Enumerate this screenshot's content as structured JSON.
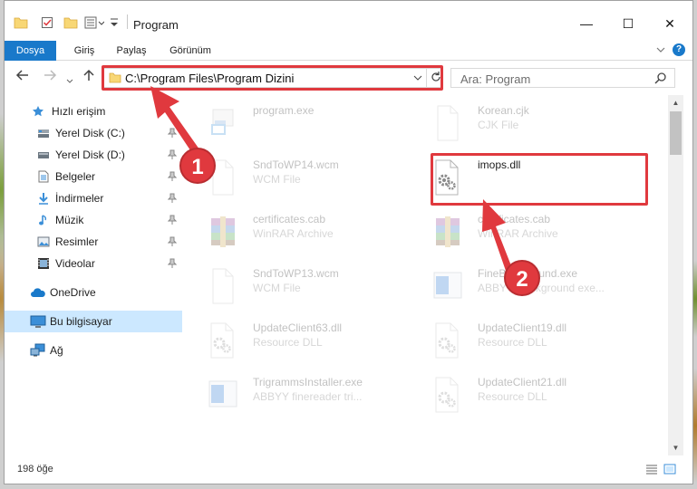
{
  "window": {
    "title": "Program",
    "controls": {
      "minimize": "—",
      "maximize": "☐",
      "close": "✕"
    }
  },
  "ribbon": {
    "tabs": [
      "Dosya",
      "Giriş",
      "Paylaş",
      "Görünüm"
    ],
    "help": "?",
    "accent": "#1979ca"
  },
  "address": {
    "path": "C:\\Program Files\\Program Dizini",
    "search_placeholder": "Ara: Program"
  },
  "nav": {
    "items": [
      {
        "label": "Hızlı erişim",
        "icon": "star-icon"
      },
      {
        "label": "Yerel Disk (C:)",
        "icon": "drive-icon",
        "pinned": true
      },
      {
        "label": "Yerel Disk (D:)",
        "icon": "drive-icon",
        "pinned": true
      },
      {
        "label": "Belgeler",
        "icon": "documents-icon",
        "pinned": true
      },
      {
        "label": "İndirmeler",
        "icon": "downloads-icon",
        "pinned": true
      },
      {
        "label": "Müzik",
        "icon": "music-icon",
        "pinned": true
      },
      {
        "label": "Resimler",
        "icon": "pictures-icon",
        "pinned": true
      },
      {
        "label": "Videolar",
        "icon": "videos-icon",
        "pinned": true
      },
      {
        "label": "OneDrive",
        "icon": "cloud-icon"
      },
      {
        "label": "Bu bilgisayar",
        "icon": "computer-icon",
        "selected": true
      },
      {
        "label": "Ağ",
        "icon": "network-icon"
      }
    ]
  },
  "files": [
    {
      "name": "program.exe",
      "type": "",
      "icon": "exe-icon"
    },
    {
      "name": "Korean.cjk",
      "type": "CJK File",
      "icon": "blank-file-icon"
    },
    {
      "name": "SndToWP14.wcm",
      "type": "WCM File",
      "icon": "blank-file-icon"
    },
    {
      "name": "imops.dll",
      "type": "",
      "icon": "dll-gear-icon",
      "highlighted": true
    },
    {
      "name": "certificates.cab",
      "type": "WinRAR Archive",
      "icon": "winrar-icon"
    },
    {
      "name": "certificates.cab",
      "type": "WinRAR Archive",
      "icon": "winrar-icon"
    },
    {
      "name": "SndToWP13.wcm",
      "type": "WCM File",
      "icon": "blank-file-icon"
    },
    {
      "name": "FineBackground.exe",
      "type": "ABBYY Background exe...",
      "icon": "exe-window-icon"
    },
    {
      "name": "UpdateClient63.dll",
      "type": "Resource DLL",
      "icon": "dll-gear-icon"
    },
    {
      "name": "UpdateClient19.dll",
      "type": "Resource DLL",
      "icon": "dll-gear-icon"
    },
    {
      "name": "TrigrammsInstaller.exe",
      "type": "ABBYY finereader tri...",
      "icon": "exe-window-icon"
    },
    {
      "name": "UpdateClient21.dll",
      "type": "Resource DLL",
      "icon": "dll-gear-icon"
    }
  ],
  "status": {
    "item_count": "198 öğe"
  },
  "annotations": {
    "step1": "1",
    "step2": "2",
    "color": "#e0393e"
  }
}
